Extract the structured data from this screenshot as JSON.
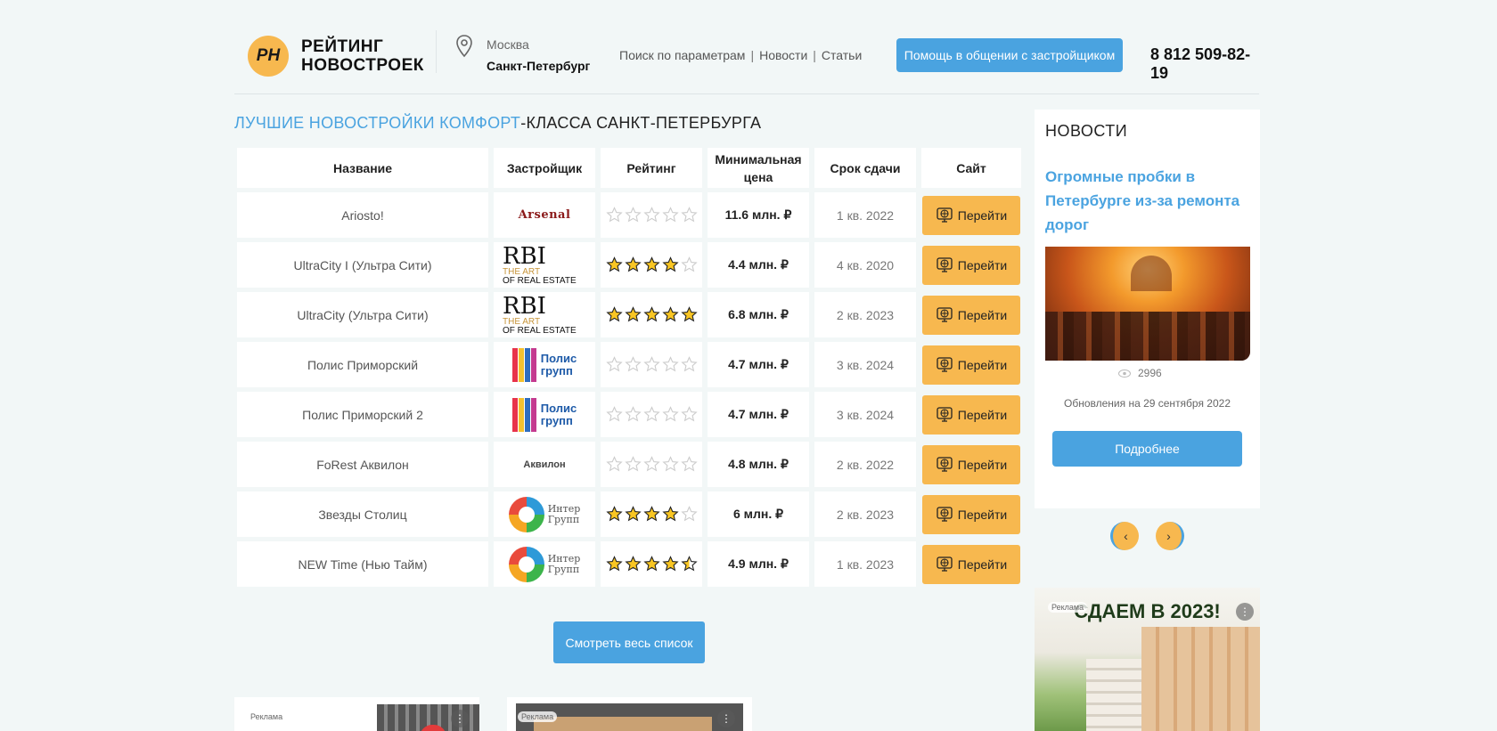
{
  "header": {
    "logo_text": "РН",
    "brand_line1": "РЕЙТИНГ",
    "brand_line2": "НОВОСТРОЕК",
    "city_inactive": "Москва",
    "city_active": "Санкт-Петербург",
    "nav": [
      "Поиск по параметрам",
      "Новости",
      "Статьи"
    ],
    "nav_sep": "|",
    "help_button": "Помощь в общении с застройщиком",
    "phone": "8 812 509-82-19"
  },
  "main": {
    "title_highlight": "ЛУЧШИЕ НОВОСТРОЙКИ КОМФОРТ",
    "title_rest": "-КЛАССА САНКТ-ПЕТЕРБУРГА",
    "columns": [
      "Название",
      "Застройщик",
      "Рейтинг",
      "Минимальная цена",
      "Срок сдачи",
      "Сайт"
    ],
    "rows": [
      {
        "name": "Ariosto!",
        "developer": "arsenal",
        "rating": 0,
        "price": "11.6 млн. ₽",
        "deadline": "1 кв. 2022",
        "site": "Перейти"
      },
      {
        "name": "UltraCity I (Ультра Сити)",
        "developer": "rbi",
        "rating": 4,
        "price": "4.4 млн. ₽",
        "deadline": "4 кв. 2020",
        "site": "Перейти"
      },
      {
        "name": "UltraCity (Ультра Сити)",
        "developer": "rbi",
        "rating": 5,
        "price": "6.8 млн. ₽",
        "deadline": "2 кв. 2023",
        "site": "Перейти"
      },
      {
        "name": "Полис Приморский",
        "developer": "polis",
        "rating": 0,
        "price": "4.7 млн. ₽",
        "deadline": "3 кв. 2024",
        "site": "Перейти"
      },
      {
        "name": "Полис Приморский 2",
        "developer": "polis",
        "rating": 0,
        "price": "4.7 млн. ₽",
        "deadline": "3 кв. 2024",
        "site": "Перейти"
      },
      {
        "name": "FoRest Аквилон",
        "developer": "akvilon",
        "rating": 0,
        "price": "4.8 млн. ₽",
        "deadline": "2 кв. 2022",
        "site": "Перейти"
      },
      {
        "name": "Звезды Столиц",
        "developer": "inter",
        "rating": 4,
        "price": "6 млн. ₽",
        "deadline": "2 кв. 2023",
        "site": "Перейти"
      },
      {
        "name": "NEW Time (Нью Тайм)",
        "developer": "inter",
        "rating": 4.5,
        "price": "4.9 млн. ₽",
        "deadline": "1 кв. 2023",
        "site": "Перейти"
      }
    ],
    "view_all_button": "Смотреть весь список"
  },
  "logos": {
    "arsenal": "Arsenal",
    "rbi_big": "RBI",
    "rbi_line1": "THE ART",
    "rbi_line2": "OF REAL ESTATE",
    "polis_line1": "Полис",
    "polis_line2": "групп",
    "akvilon": "Аквилон",
    "inter_line1": "Интер",
    "inter_line2": "Групп"
  },
  "news": {
    "heading": "НОВОСТИ",
    "title": "Огромные пробки в Петербурге из-за ремонта дорог",
    "views": "2996",
    "updated": "Обновления на 29 сентября 2022",
    "more_button": "Подробнее",
    "prev_icon": "‹",
    "next_icon": "›"
  },
  "ads": {
    "label": "Реклама",
    "side_headline": "СДАЕМ В 2023!",
    "menu_icon": "⋮"
  },
  "colors": {
    "accent_blue": "#4aa3e0",
    "accent_orange": "#f7b84f",
    "star_fill": "#f9c623"
  }
}
